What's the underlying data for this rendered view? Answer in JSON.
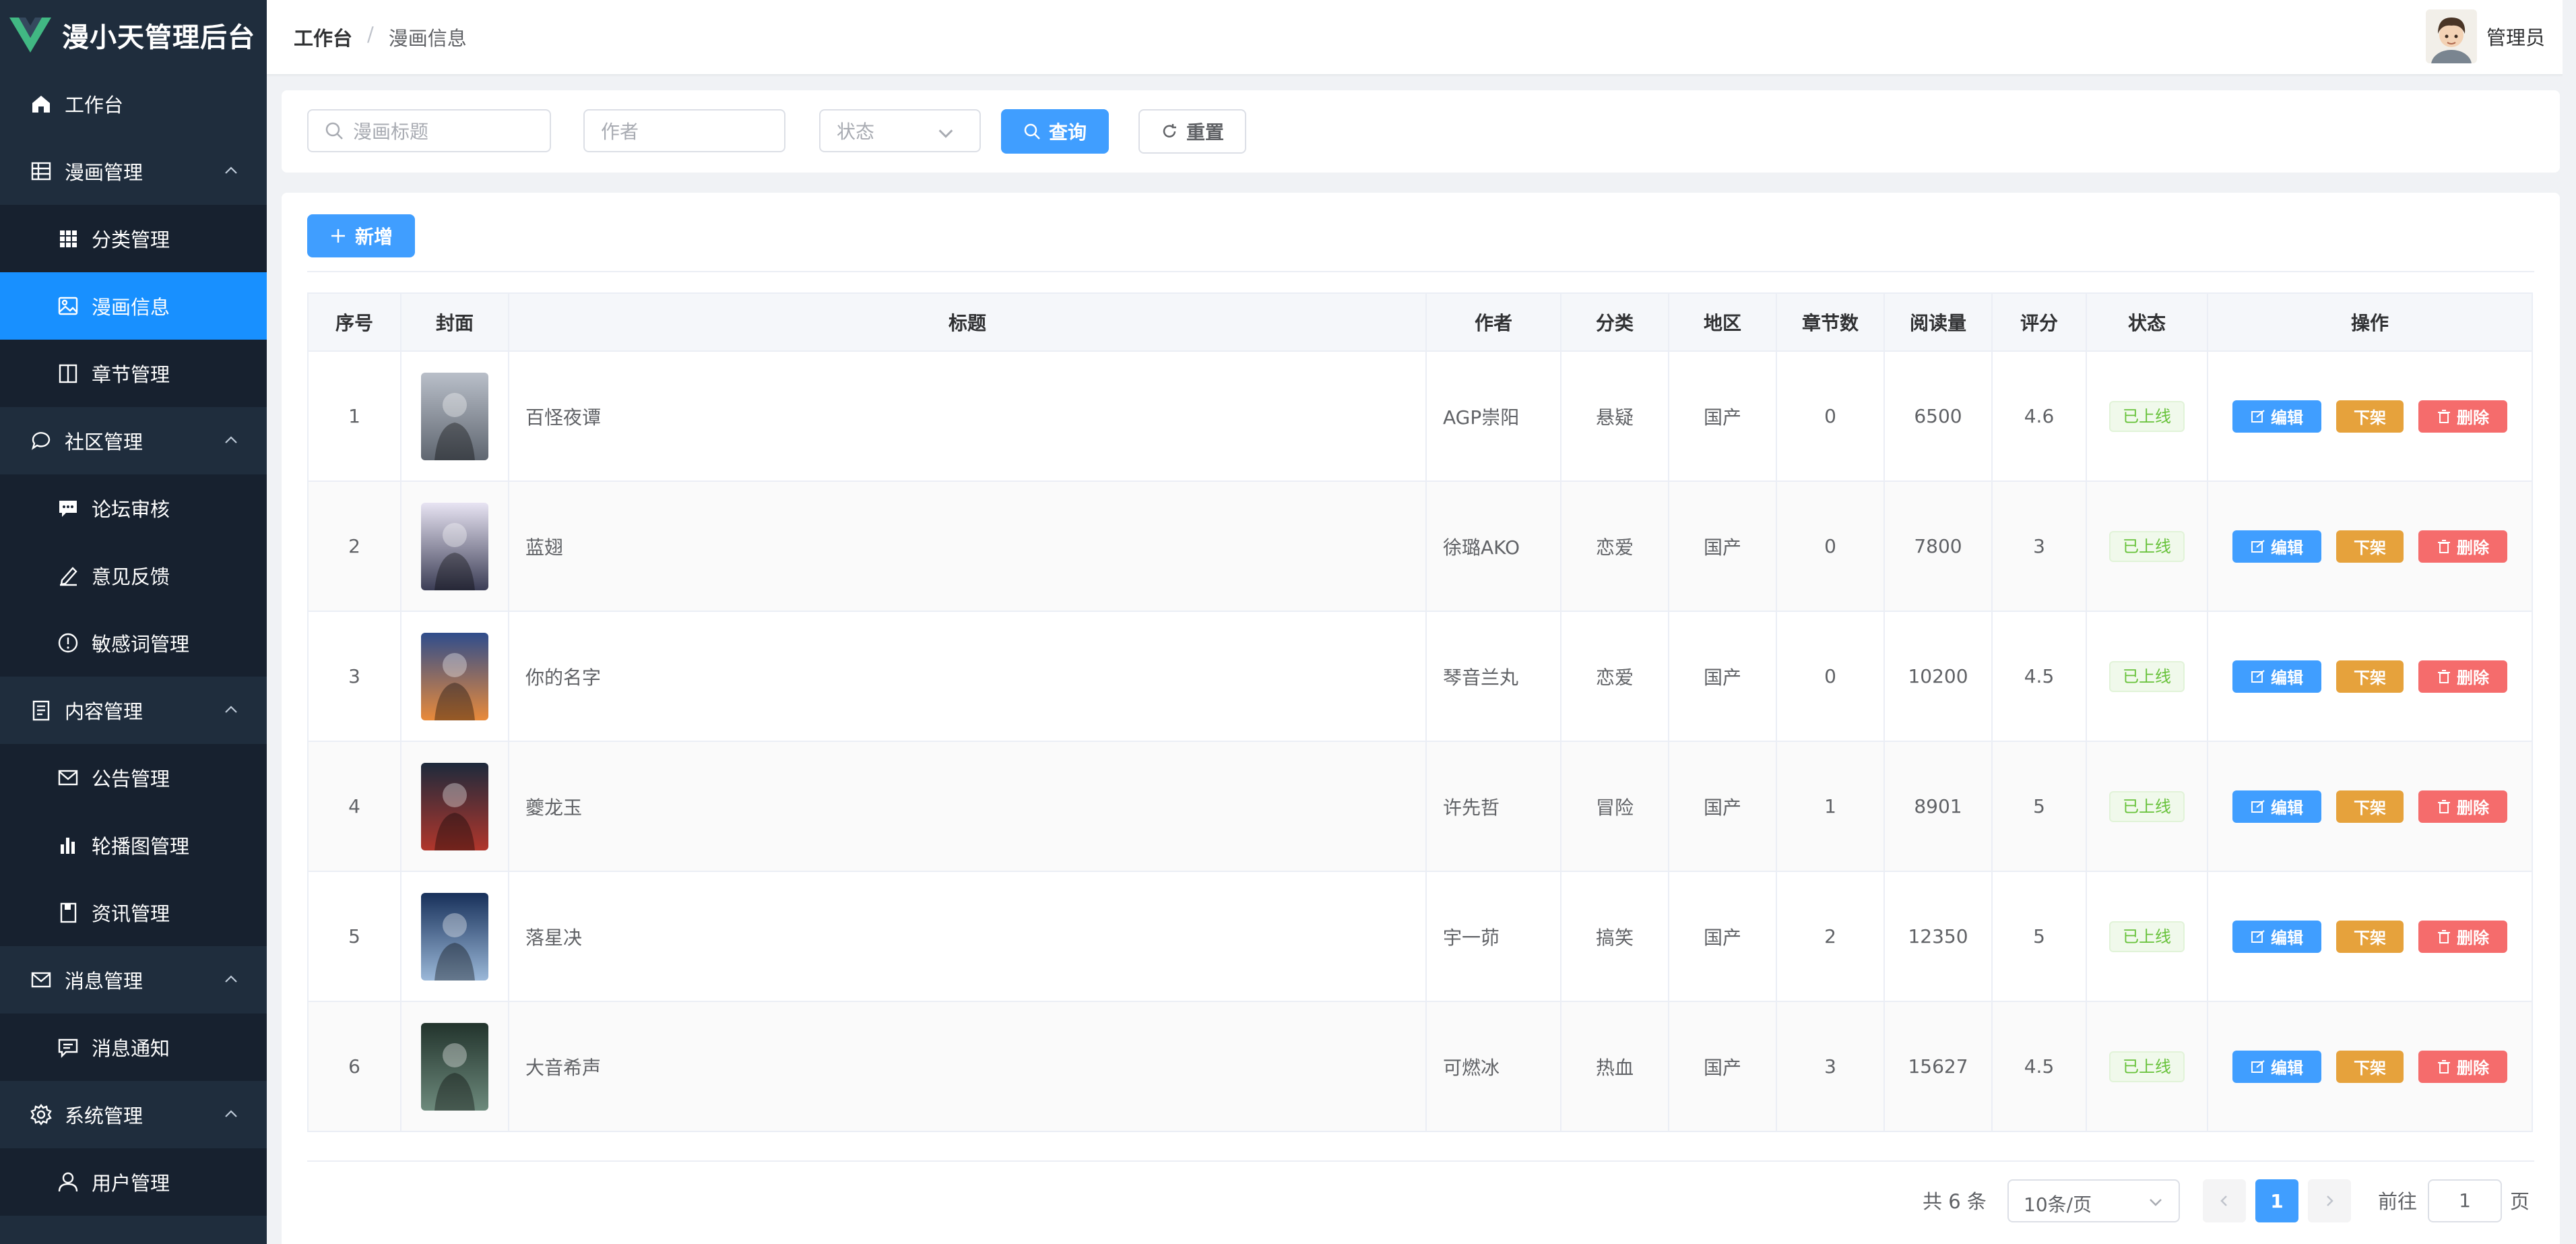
{
  "app": {
    "title": "漫小天管理后台",
    "brand_color": "#41b883"
  },
  "breadcrumb": [
    "工作台",
    "漫画信息"
  ],
  "breadcrumb_sep": "/",
  "user": {
    "name": "管理员"
  },
  "sidebar": {
    "items": [
      {
        "label": "工作台",
        "icon": "home-icon",
        "type": "group",
        "has_chevron": false
      },
      {
        "label": "漫画管理",
        "icon": "grid-table-icon",
        "type": "group",
        "has_chevron": true
      },
      {
        "label": "分类管理",
        "icon": "apps-icon",
        "type": "sub"
      },
      {
        "label": "漫画信息",
        "icon": "picture-icon",
        "type": "sub",
        "active": true
      },
      {
        "label": "章节管理",
        "icon": "book-icon",
        "type": "sub"
      },
      {
        "label": "社区管理",
        "icon": "chat-bubble-icon",
        "type": "group",
        "has_chevron": true
      },
      {
        "label": "论坛审核",
        "icon": "message-icon",
        "type": "sub"
      },
      {
        "label": "意见反馈",
        "icon": "edit-pen-icon",
        "type": "sub"
      },
      {
        "label": "敏感词管理",
        "icon": "warning-circle-icon",
        "type": "sub"
      },
      {
        "label": "内容管理",
        "icon": "document-icon",
        "type": "group",
        "has_chevron": true
      },
      {
        "label": "公告管理",
        "icon": "mail-icon",
        "type": "sub"
      },
      {
        "label": "轮播图管理",
        "icon": "bar-chart-icon",
        "type": "sub"
      },
      {
        "label": "资讯管理",
        "icon": "notebook-icon",
        "type": "sub"
      },
      {
        "label": "消息管理",
        "icon": "envelope-icon",
        "type": "group",
        "has_chevron": true
      },
      {
        "label": "消息通知",
        "icon": "chat-square-icon",
        "type": "sub"
      },
      {
        "label": "系统管理",
        "icon": "gear-icon",
        "type": "group",
        "has_chevron": true
      },
      {
        "label": "用户管理",
        "icon": "user-icon",
        "type": "sub"
      }
    ]
  },
  "search": {
    "title_placeholder": "漫画标题",
    "author_placeholder": "作者",
    "status_placeholder": "状态",
    "query_label": "查询",
    "reset_label": "重置"
  },
  "toolbar": {
    "add_label": "新增"
  },
  "table": {
    "columns": [
      "序号",
      "封面",
      "标题",
      "作者",
      "分类",
      "地区",
      "章节数",
      "阅读量",
      "评分",
      "状态",
      "操作"
    ],
    "actions": {
      "edit": "编辑",
      "offline": "下架",
      "delete": "删除"
    },
    "rows": [
      {
        "index": "1",
        "title": "百怪夜谭",
        "author": "AGP崇阳",
        "category": "悬疑",
        "region": "国产",
        "chapters": "0",
        "reads": "6500",
        "score": "4.6",
        "status": "已上线",
        "cover_colors": [
          "#b9bfc9",
          "#5f6670"
        ]
      },
      {
        "index": "2",
        "title": "蓝翅",
        "author": "徐璐AKO",
        "category": "恋爱",
        "region": "国产",
        "chapters": "0",
        "reads": "7800",
        "score": "3",
        "status": "已上线",
        "cover_colors": [
          "#e8e4f3",
          "#3b3d55"
        ]
      },
      {
        "index": "3",
        "title": "你的名字",
        "author": "琴音兰丸",
        "category": "恋爱",
        "region": "国产",
        "chapters": "0",
        "reads": "10200",
        "score": "4.5",
        "status": "已上线",
        "cover_colors": [
          "#2f4d8c",
          "#e98a3a"
        ]
      },
      {
        "index": "4",
        "title": "夔龙玉",
        "author": "许先哲",
        "category": "冒险",
        "region": "国产",
        "chapters": "1",
        "reads": "8901",
        "score": "5",
        "status": "已上线",
        "cover_colors": [
          "#1d2a3c",
          "#b1362b"
        ]
      },
      {
        "index": "5",
        "title": "落星决",
        "author": "宇一茆",
        "category": "搞笑",
        "region": "国产",
        "chapters": "2",
        "reads": "12350",
        "score": "5",
        "status": "已上线",
        "cover_colors": [
          "#17305a",
          "#9bb8d8"
        ]
      },
      {
        "index": "6",
        "title": "大音希声",
        "author": "可燃冰",
        "category": "热血",
        "region": "国产",
        "chapters": "3",
        "reads": "15627",
        "score": "4.5",
        "status": "已上线",
        "cover_colors": [
          "#22332c",
          "#6d8a7c"
        ]
      }
    ]
  },
  "pagination": {
    "total_label": "共 6 条",
    "page_size": "10条/页",
    "current_page": "1",
    "goto_prefix": "前往",
    "goto_value": "1",
    "goto_suffix": "页"
  }
}
